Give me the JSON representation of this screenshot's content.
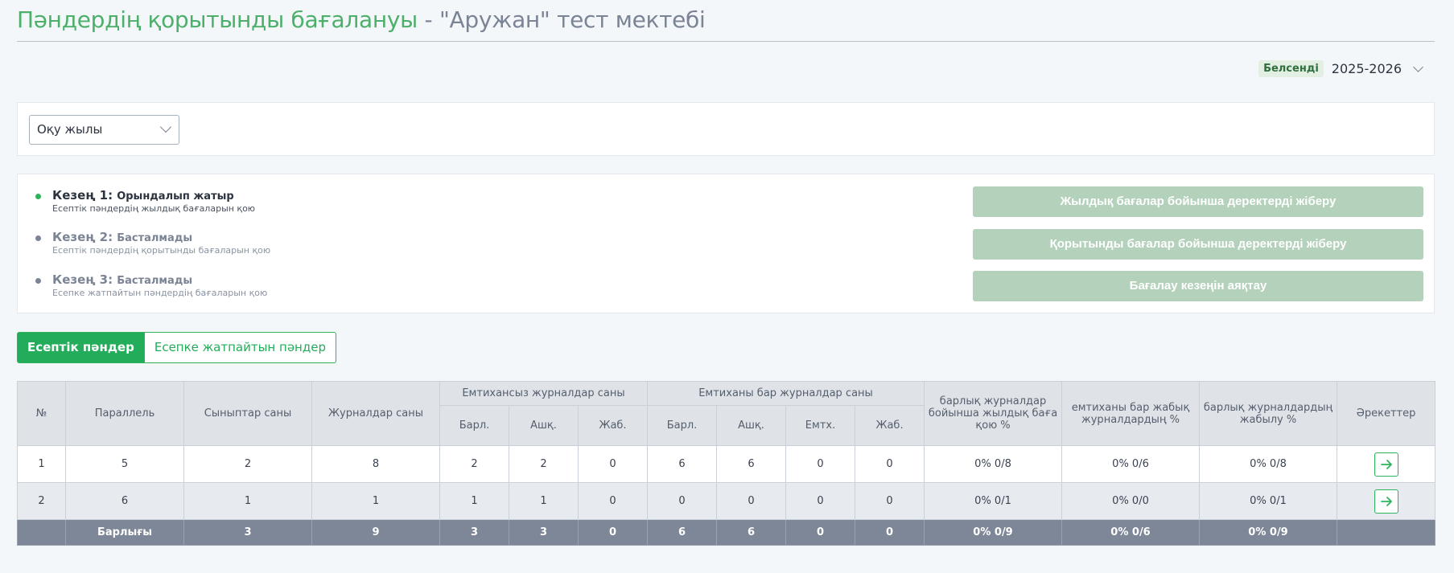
{
  "page": {
    "title_main": "Пәндердің қорытынды бағалануы",
    "title_sep": " - ",
    "title_school": "\"Аружан\" тест мектебі"
  },
  "year_selector": {
    "badge": "Белсенді",
    "year": "2025-2026"
  },
  "filter": {
    "academic_year_select": "Оқу жылы"
  },
  "stages": [
    {
      "name": "Кезең 1:",
      "status": "Орындалып жатыр",
      "desc": "Есептік пәндердің жылдық бағаларын қою"
    },
    {
      "name": "Кезең 2:",
      "status": "Басталмады",
      "desc": "Есептік пәндердің қорытынды бағаларын қою"
    },
    {
      "name": "Кезең 3:",
      "status": "Басталмады",
      "desc": "Есепке жатпайтын пәндердің бағаларын қою"
    }
  ],
  "actions": {
    "send_annual": "Жылдық бағалар бойынша деректерді жіберу",
    "send_final": "Қорытынды бағалар бойынша деректерді жіберу",
    "finish_period": "Бағалау кезеңін аяқтау"
  },
  "tabs": {
    "counted": "Есептік пәндер",
    "uncounted": "Есепке жатпайтын пәндер"
  },
  "colors": {
    "accent": "#23ad5a",
    "disabled_button": "#b3d1bb",
    "title_green": "#4caf6a",
    "total_row": "#7e8798"
  },
  "table": {
    "headers": {
      "no": "№",
      "parallel": "Параллель",
      "classes": "Сыныптар саны",
      "journals": "Журналдар саны",
      "no_exam_group": "Емтихансыз журналдар саны",
      "exam_group": "Емтиханы бар журналдар саны",
      "annual_pct": "барлық журналдар бойынша жылдық баға қою %",
      "exam_closed_pct": "емтиханы бар жабық журналдардың %",
      "all_closed_pct": "барлық журналдардың жабылу %",
      "actions": "Әрекеттер",
      "total_sub": "Барл.",
      "open_sub": "Ашқ.",
      "closed_sub": "Жаб.",
      "exam_sub": "Емтх."
    },
    "rows": [
      {
        "no": "1",
        "parallel": "5",
        "classes": "2",
        "journals": "8",
        "ne_total": "2",
        "ne_open": "2",
        "ne_closed": "0",
        "e_total": "6",
        "e_open": "6",
        "e_exam": "0",
        "e_closed": "0",
        "annual": "0% 0/8",
        "exam_closed": "0% 0/6",
        "all_closed": "0% 0/8"
      },
      {
        "no": "2",
        "parallel": "6",
        "classes": "1",
        "journals": "1",
        "ne_total": "1",
        "ne_open": "1",
        "ne_closed": "0",
        "e_total": "0",
        "e_open": "0",
        "e_exam": "0",
        "e_closed": "0",
        "annual": "0% 0/1",
        "exam_closed": "0% 0/0",
        "all_closed": "0% 0/1"
      }
    ],
    "total": {
      "label": "Барлығы",
      "classes": "3",
      "journals": "9",
      "ne_total": "3",
      "ne_open": "3",
      "ne_closed": "0",
      "e_total": "6",
      "e_open": "6",
      "e_exam": "0",
      "e_closed": "0",
      "annual": "0% 0/9",
      "exam_closed": "0% 0/6",
      "all_closed": "0% 0/9"
    }
  }
}
